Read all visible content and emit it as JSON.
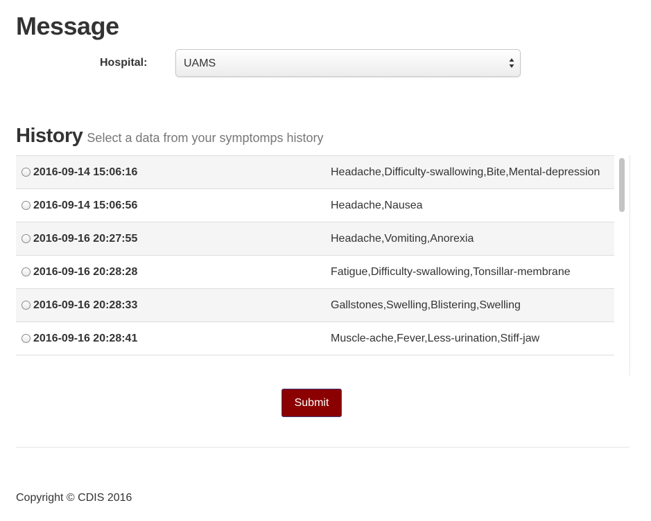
{
  "page_title": "Message",
  "hospital": {
    "label": "Hospital:",
    "selected": "UAMS",
    "icon": "select-arrows-icon"
  },
  "history": {
    "title": "History",
    "subtitle": "Select a data from your symptomps history",
    "rows": [
      {
        "date": "2016-09-14 15:06:16",
        "symptoms": "Headache,Difficulty-swallowing,Bite,Mental-depression"
      },
      {
        "date": "2016-09-14 15:06:56",
        "symptoms": "Headache,Nausea"
      },
      {
        "date": "2016-09-16 20:27:55",
        "symptoms": "Headache,Vomiting,Anorexia"
      },
      {
        "date": "2016-09-16 20:28:28",
        "symptoms": "Fatigue,Difficulty-swallowing,Tonsillar-membrane"
      },
      {
        "date": "2016-09-16 20:28:33",
        "symptoms": "Gallstones,Swelling,Blistering,Swelling"
      },
      {
        "date": "2016-09-16 20:28:41",
        "symptoms": "Muscle-ache,Fever,Less-urination,Stiff-jaw"
      }
    ]
  },
  "submit_label": "Submit",
  "colors": {
    "submit_bg": "#8b0000",
    "row_stripe": "#f5f5f5"
  },
  "footer": {
    "copyright": "Copyright © CDIS 2016"
  }
}
